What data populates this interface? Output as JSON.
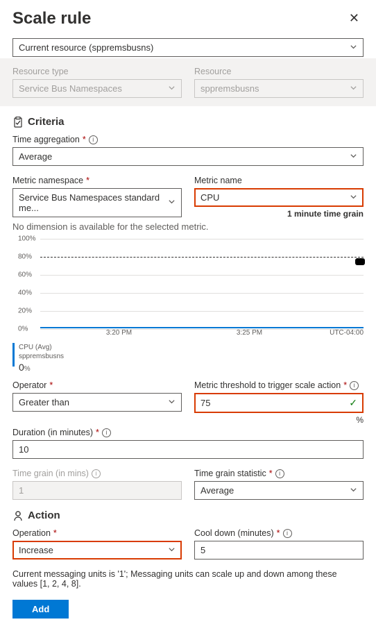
{
  "header": {
    "title": "Scale rule"
  },
  "main_select": {
    "value": "Current resource (sppremsbusns)"
  },
  "resource": {
    "type_label": "Resource type",
    "type_value": "Service Bus Namespaces",
    "res_label": "Resource",
    "res_value": "sppremsbusns"
  },
  "criteria": {
    "heading": "Criteria",
    "time_agg_label": "Time aggregation",
    "time_agg_value": "Average",
    "namespace_label": "Metric namespace",
    "namespace_value": "Service Bus Namespaces standard me...",
    "metric_name_label": "Metric name",
    "metric_name_value": "CPU",
    "time_grain_note": "1 minute time grain",
    "no_dimension": "No dimension is available for the selected metric.",
    "operator_label": "Operator",
    "operator_value": "Greater than",
    "threshold_label": "Metric threshold to trigger scale action",
    "threshold_value": "75",
    "threshold_unit": "%",
    "duration_label": "Duration (in minutes)",
    "duration_value": "10",
    "grain_label": "Time grain (in mins)",
    "grain_value": "1",
    "grain_stat_label": "Time grain statistic",
    "grain_stat_value": "Average"
  },
  "action": {
    "heading": "Action",
    "operation_label": "Operation",
    "operation_value": "Increase",
    "cooldown_label": "Cool down (minutes)",
    "cooldown_value": "5",
    "footnote": "Current messaging units is '1'; Messaging units can scale up and down among these values [1, 2, 4, 8].",
    "add_label": "Add"
  },
  "chart_data": {
    "type": "line",
    "title": "",
    "ylabel": "",
    "ylim": [
      0,
      100
    ],
    "yticks": [
      "100%",
      "80%",
      "60%",
      "40%",
      "20%",
      "0%"
    ],
    "xticks": [
      "3:20 PM",
      "3:25 PM"
    ],
    "tz": "UTC-04:00",
    "threshold_line_y": 80,
    "series": [
      {
        "name": "CPU (Avg)",
        "resource": "sppremsbusns",
        "current_value": 0,
        "unit": "%",
        "values_flat_at": 0,
        "color": "#0078d4"
      }
    ]
  }
}
